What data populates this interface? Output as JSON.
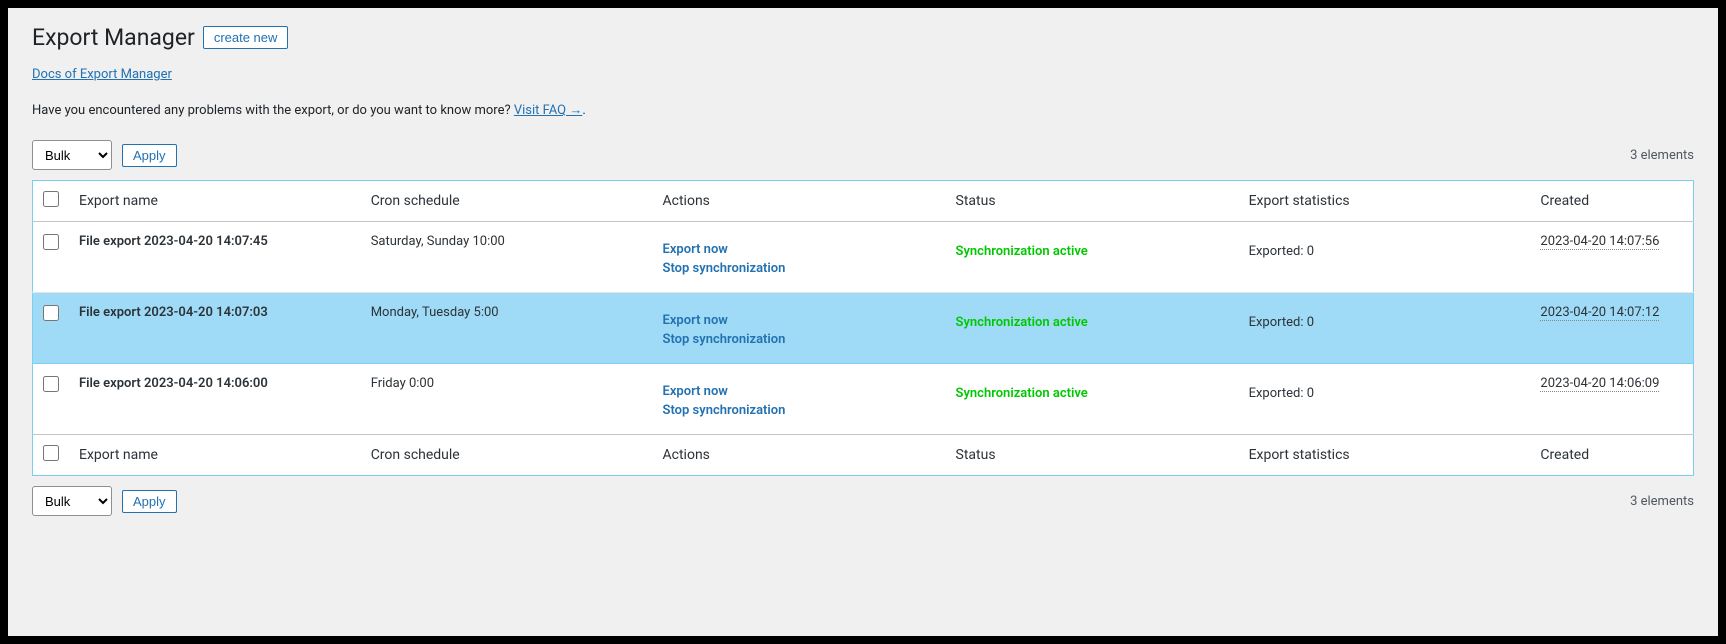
{
  "header": {
    "title": "Export Manager",
    "create_label": "create new",
    "docs_link": "Docs of Export Manager",
    "faq_prefix": "Have you encountered any problems with the export, or do you want to know more? ",
    "faq_link": "Visit FAQ →"
  },
  "toolbar": {
    "bulk_label": "Bulk",
    "apply_label": "Apply",
    "count_text": "3 elements"
  },
  "columns": {
    "name": "Export name",
    "cron": "Cron schedule",
    "actions": "Actions",
    "status": "Status",
    "stats": "Export statistics",
    "created": "Created"
  },
  "actions": {
    "export_now": "Export now",
    "stop_sync": "Stop synchronization"
  },
  "rows": [
    {
      "name": "File export 2023-04-20 14:07:45",
      "cron": "Saturday, Sunday 10:00",
      "status": "Synchronization active",
      "stats": "Exported: 0",
      "created": "2023-04-20 14:07:56",
      "highlight": false
    },
    {
      "name": "File export 2023-04-20 14:07:03",
      "cron": "Monday, Tuesday 5:00",
      "status": "Synchronization active",
      "stats": "Exported: 0",
      "created": "2023-04-20 14:07:12",
      "highlight": true
    },
    {
      "name": "File export 2023-04-20 14:06:00",
      "cron": "Friday 0:00",
      "status": "Synchronization active",
      "stats": "Exported: 0",
      "created": "2023-04-20 14:06:09",
      "highlight": false
    }
  ]
}
